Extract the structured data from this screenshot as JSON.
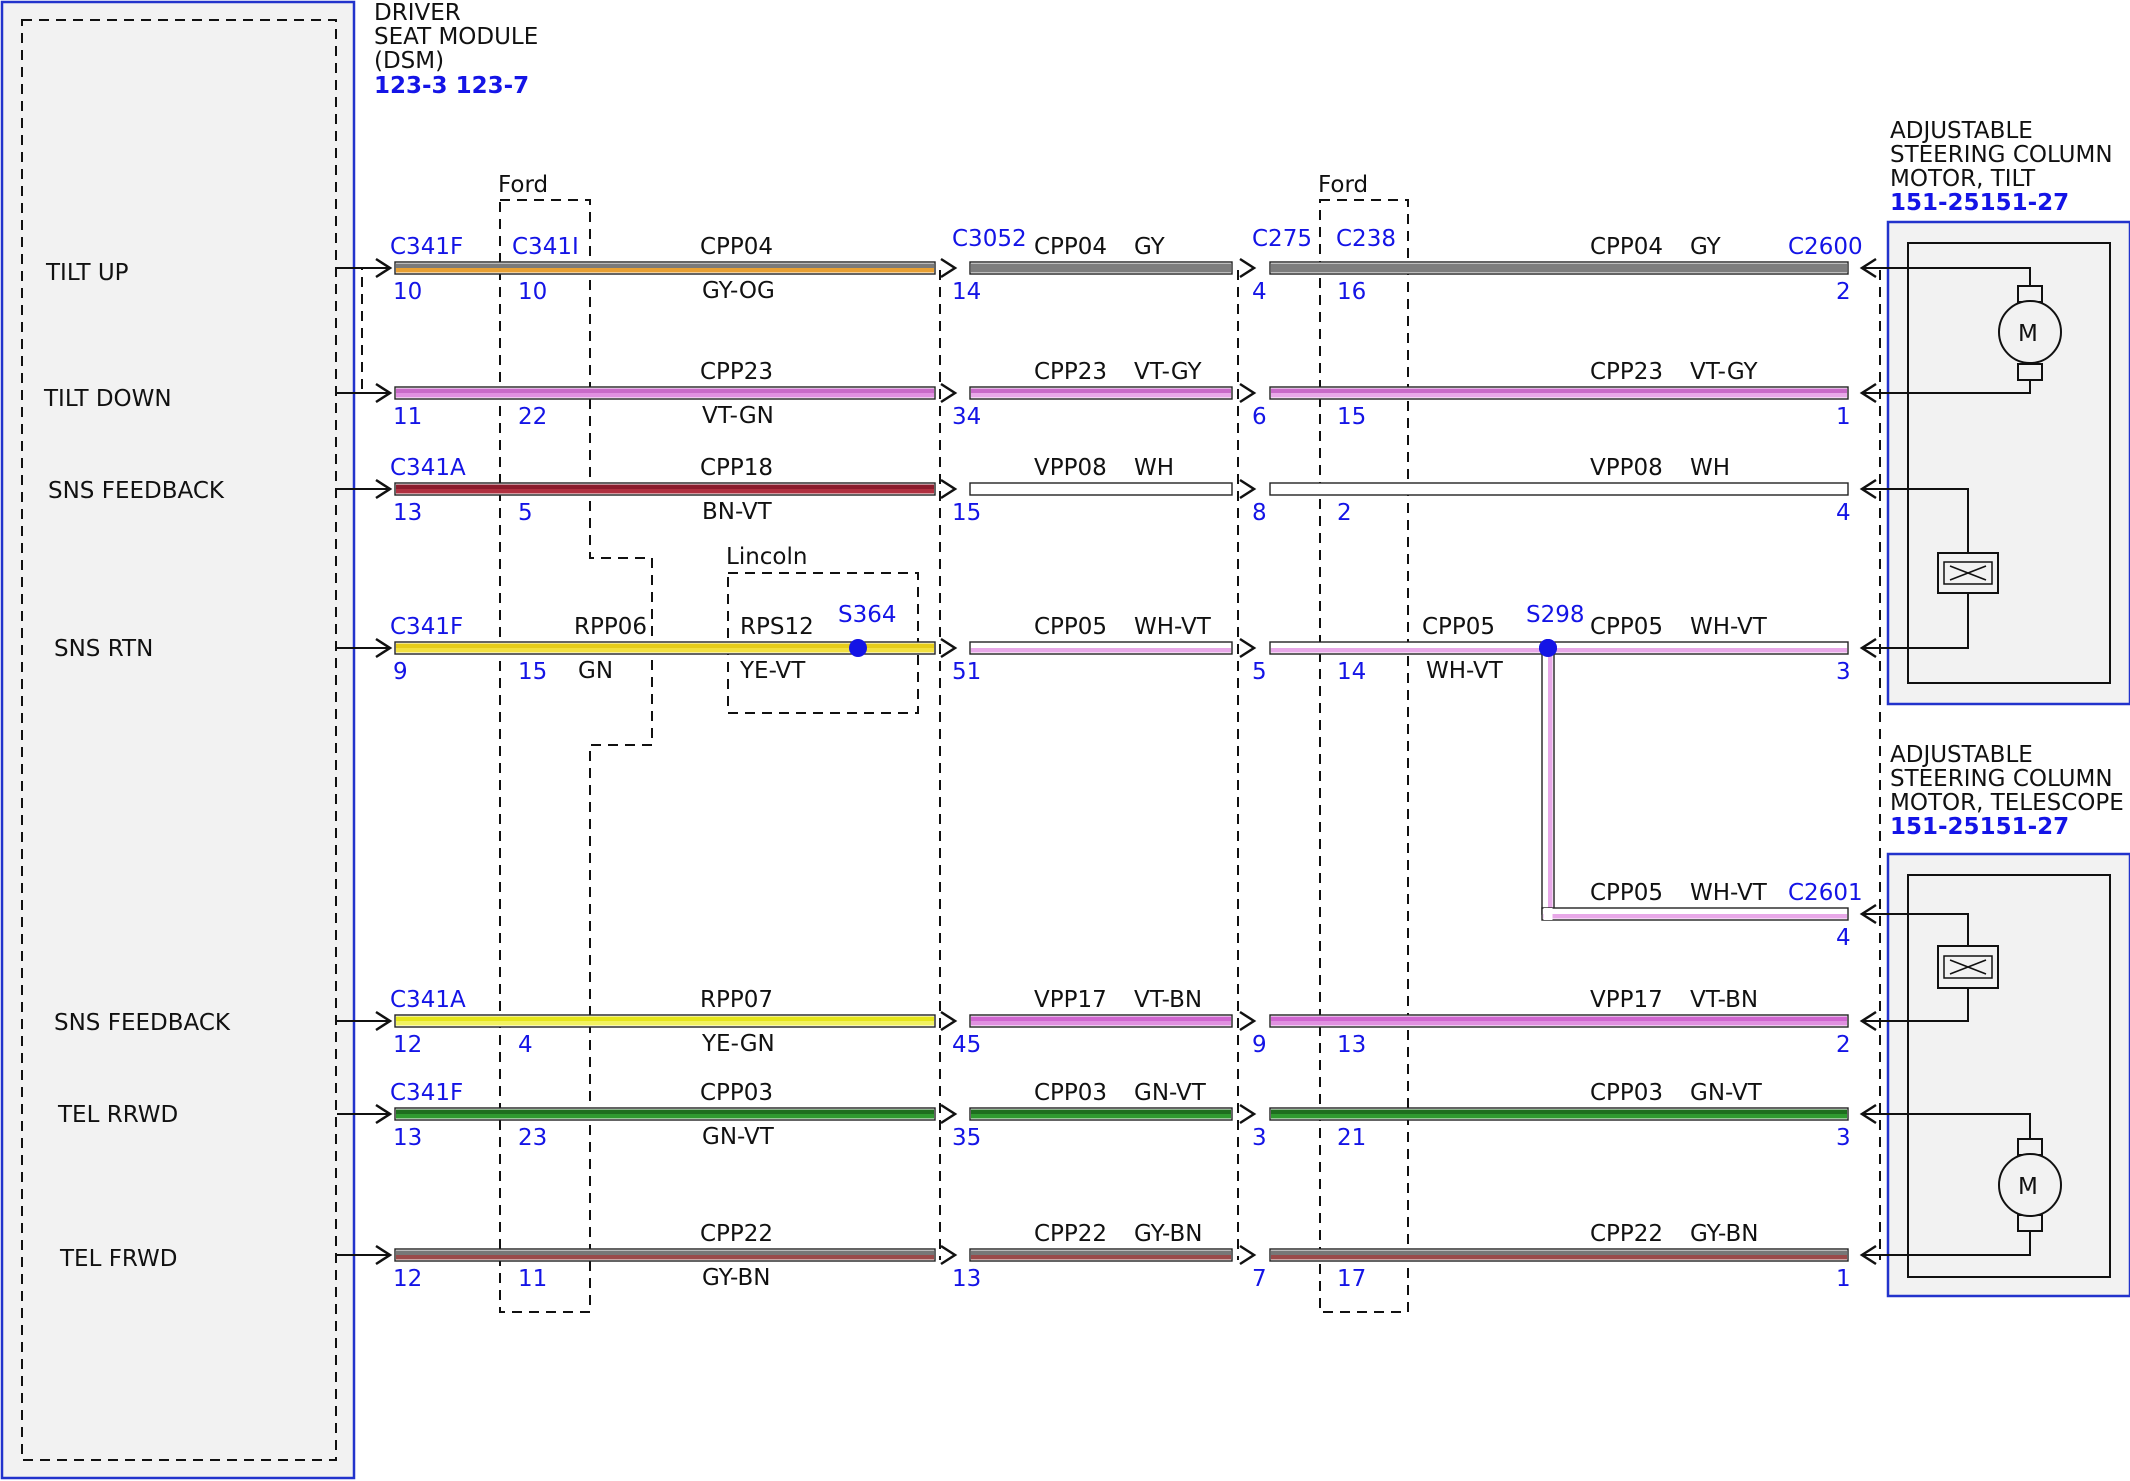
{
  "dsm": {
    "title": [
      "DRIVER",
      "SEAT MODULE",
      "(DSM)"
    ],
    "refs": "123-3 123-7",
    "pins": [
      "TILT UP",
      "TILT DOWN",
      "SNS FEEDBACK",
      "SNS RTN",
      "SNS FEEDBACK",
      "TEL RRWD",
      "TEL FRWD"
    ]
  },
  "tilt_motor": {
    "title": [
      "ADJUSTABLE",
      "STEERING COLUMN",
      "MOTOR, TILT"
    ],
    "refs": "151-25151-27",
    "motor_symbol": "M"
  },
  "tel_motor": {
    "title": [
      "ADJUSTABLE",
      "STEERING COLUMN",
      "MOTOR, TELESCOPE"
    ],
    "refs": "151-25151-27",
    "motor_symbol": "M"
  },
  "boxes": {
    "ford_left": "Ford",
    "ford_right": "Ford",
    "lincoln": "Lincoln"
  },
  "colors": {
    "GY-OG": [
      "#7a7a7a",
      "#e8a033"
    ],
    "GY": [
      "#7d7d7d",
      "#7d7d7d"
    ],
    "VT-GN": [
      "#c86ac8",
      "#e090e0"
    ],
    "VT-GY": [
      "#c86ac8",
      "#e8a8e8"
    ],
    "BN-VT": [
      "#8b1c2c",
      "#b03040"
    ],
    "WH": [
      "#ffffff",
      "#ffffff"
    ],
    "GN": [
      "#e6cc1a",
      "#f2e040"
    ],
    "YE-VT": [
      "#e6cc1a",
      "#f2e040"
    ],
    "WH-VT": [
      "#ffffff",
      "#e8a8e8"
    ],
    "YE-GN": [
      "#e6e61a",
      "#f2f260"
    ],
    "VT-BN": [
      "#d066d0",
      "#e090e0"
    ],
    "GN-VT": [
      "#1e6e1e",
      "#2f9a2f"
    ],
    "GY-BN": [
      "#777777",
      "#9a4a4a"
    ]
  },
  "wires": [
    {
      "pin": "TILT UP",
      "segments": [
        {
          "circuit": "CPP04",
          "color": "GY-OG",
          "conn_from": "C341F",
          "conn_from2": "C341I",
          "pin_from": "10",
          "pin_from2": "10"
        },
        {
          "circuit": "CPP04",
          "color": "GY",
          "conn_from": "C3052",
          "pin_from": "14"
        },
        {
          "circuit": "CPP04",
          "color": "GY",
          "conn_from": "C275",
          "conn_from2": "C238",
          "pin_from": "4",
          "pin_from2": "16",
          "conn_to": "C2600",
          "pin_to": "2"
        }
      ]
    },
    {
      "pin": "TILT DOWN",
      "segments": [
        {
          "circuit": "CPP23",
          "color": "VT-GN",
          "pin_from": "11",
          "pin_from2": "22"
        },
        {
          "circuit": "CPP23",
          "color": "VT-GY",
          "pin_from": "34"
        },
        {
          "circuit": "CPP23",
          "color": "VT-GY",
          "pin_from": "6",
          "pin_from2": "15",
          "pin_to": "1"
        }
      ]
    },
    {
      "pin": "SNS FEEDBACK",
      "segments": [
        {
          "circuit": "CPP18",
          "color": "BN-VT",
          "conn_from": "C341A",
          "pin_from": "13",
          "pin_from2": "5"
        },
        {
          "circuit": "VPP08",
          "color": "WH",
          "pin_from": "15"
        },
        {
          "circuit": "VPP08",
          "color": "WH",
          "pin_from": "8",
          "pin_from2": "2",
          "pin_to": "4"
        }
      ]
    },
    {
      "pin": "SNS RTN",
      "segments": [
        {
          "circuit": "RPP06",
          "color": "GN",
          "conn_from": "C341F",
          "pin_from": "9",
          "pin_from2": "15",
          "circuit2": "RPS12",
          "color2": "YE-VT",
          "splice": "S364"
        },
        {
          "circuit": "CPP05",
          "color": "WH-VT",
          "pin_from": "51"
        },
        {
          "circuit": "CPP05",
          "color": "WH-VT",
          "pin_from": "5",
          "pin_from2": "14",
          "splice": "S298",
          "circuit2": "CPP05",
          "color2": "WH-VT",
          "pin_to": "3"
        }
      ]
    },
    {
      "pin": "SNS RTN",
      "segments": [
        {
          "circuit": "CPP05",
          "color": "WH-VT",
          "conn_to": "C2601",
          "pin_to": "4"
        }
      ]
    },
    {
      "pin": "SNS FEEDBACK",
      "segments": [
        {
          "circuit": "RPP07",
          "color": "YE-GN",
          "conn_from": "C341A",
          "pin_from": "12",
          "pin_from2": "4"
        },
        {
          "circuit": "VPP17",
          "color": "VT-BN",
          "pin_from": "45"
        },
        {
          "circuit": "VPP17",
          "color": "VT-BN",
          "pin_from": "9",
          "pin_from2": "13",
          "pin_to": "2"
        }
      ]
    },
    {
      "pin": "TEL RRWD",
      "segments": [
        {
          "circuit": "CPP03",
          "color": "GN-VT",
          "conn_from": "C341F",
          "pin_from": "13",
          "pin_from2": "23"
        },
        {
          "circuit": "CPP03",
          "color": "GN-VT",
          "pin_from": "35"
        },
        {
          "circuit": "CPP03",
          "color": "GN-VT",
          "pin_from": "3",
          "pin_from2": "21",
          "pin_to": "3"
        }
      ]
    },
    {
      "pin": "TEL FRWD",
      "segments": [
        {
          "circuit": "CPP22",
          "color": "GY-BN",
          "pin_from": "12",
          "pin_from2": "11"
        },
        {
          "circuit": "CPP22",
          "color": "GY-BN",
          "pin_from": "13"
        },
        {
          "circuit": "CPP22",
          "color": "GY-BN",
          "pin_from": "7",
          "pin_from2": "17",
          "pin_to": "1"
        }
      ]
    }
  ]
}
